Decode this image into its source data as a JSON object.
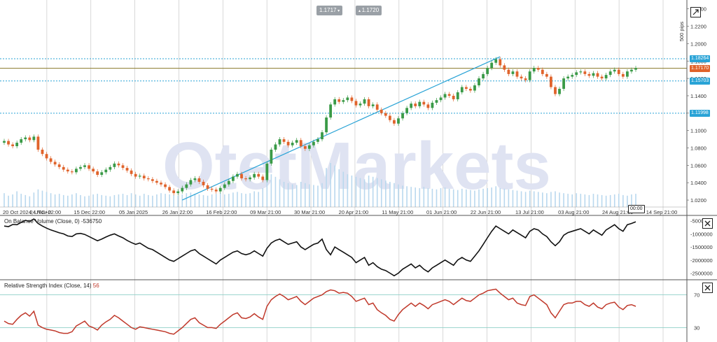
{
  "header": {
    "sell_price": "1.1717",
    "buy_price": "1.1720"
  },
  "main_chart": {
    "pips_label": "500 pips",
    "yticks": [
      "1.2400",
      "1.2200",
      "1.2000",
      "1.1800",
      "1.1600",
      "1.1400",
      "1.1200",
      "1.1000",
      "1.0800",
      "1.0600",
      "1.0400",
      "1.0200"
    ],
    "ytick_values": [
      1.24,
      1.22,
      1.2,
      1.18,
      1.16,
      1.14,
      1.12,
      1.1,
      1.08,
      1.06,
      1.04,
      1.02
    ],
    "xticks": [
      "20 Oct 2024, UTC+0",
      "24 Nov 22:00",
      "15 Dec 22:00",
      "05 Jan 2025",
      "26 Jan 22:00",
      "16 Feb 22:00",
      "09 Mar 21:00",
      "30 Mar 21:00",
      "20 Apr 21:00",
      "11 May 21:00",
      "01 Jun 21:00",
      "22 Jun 21:00",
      "13 Jul 21:00",
      "03 Aug 21:00",
      "24 Aug 21:00",
      "14 Sep 21:00"
    ],
    "time_badge": "00:00",
    "levels": [
      {
        "value": 1.18264,
        "label": "1.18264",
        "color": "#29a3d6",
        "style": "dotted"
      },
      {
        "value": 1.1717,
        "label": "1.17170",
        "color": "#e0632b",
        "style": "solid"
      },
      {
        "value": 1.15703,
        "label": "1.15703",
        "color": "#29a3d6",
        "style": "dotted"
      },
      {
        "value": 1.11998,
        "label": "1.11998",
        "color": "#29a3d6",
        "style": "dotted"
      }
    ],
    "watermark": "OtetMarkets"
  },
  "indicators": {
    "obv_label": "On Balance Volume (Close, 0)",
    "obv_value": "-536750",
    "obv_yticks": [
      "-500000",
      "-1000000",
      "-1500000",
      "-2000000",
      "-2500000"
    ],
    "rsi_label": "Relative Strength Index (Close, 14)",
    "rsi_value": "56",
    "rsi_yticks": [
      "70",
      "30"
    ]
  },
  "chart_data": {
    "type": "candlestick",
    "symbol_note": "",
    "y_range": [
      1.012,
      1.247
    ],
    "up_color": "#3a9a47",
    "down_color": "#e0632b",
    "close": [
      1.088,
      1.084,
      1.082,
      1.086,
      1.09,
      1.092,
      1.089,
      1.093,
      1.078,
      1.073,
      1.068,
      1.064,
      1.061,
      1.058,
      1.055,
      1.053,
      1.052,
      1.056,
      1.058,
      1.06,
      1.056,
      1.053,
      1.049,
      1.052,
      1.055,
      1.058,
      1.062,
      1.06,
      1.057,
      1.054,
      1.05,
      1.047,
      1.048,
      1.045,
      1.044,
      1.042,
      1.04,
      1.038,
      1.035,
      1.031,
      1.028,
      1.03,
      1.034,
      1.038,
      1.043,
      1.045,
      1.041,
      1.037,
      1.033,
      1.032,
      1.03,
      1.034,
      1.038,
      1.042,
      1.047,
      1.05,
      1.045,
      1.044,
      1.046,
      1.05,
      1.047,
      1.043,
      1.062,
      1.078,
      1.084,
      1.09,
      1.087,
      1.083,
      1.086,
      1.089,
      1.082,
      1.079,
      1.083,
      1.087,
      1.09,
      1.098,
      1.115,
      1.13,
      1.136,
      1.133,
      1.135,
      1.138,
      1.134,
      1.129,
      1.131,
      1.136,
      1.128,
      1.13,
      1.124,
      1.12,
      1.117,
      1.112,
      1.108,
      1.114,
      1.12,
      1.126,
      1.131,
      1.128,
      1.133,
      1.13,
      1.126,
      1.132,
      1.135,
      1.138,
      1.142,
      1.14,
      1.136,
      1.144,
      1.15,
      1.148,
      1.146,
      1.152,
      1.16,
      1.165,
      1.172,
      1.178,
      1.182,
      1.175,
      1.17,
      1.165,
      1.168,
      1.162,
      1.16,
      1.158,
      1.168,
      1.172,
      1.17,
      1.165,
      1.162,
      1.15,
      1.142,
      1.148,
      1.16,
      1.162,
      1.164,
      1.167,
      1.168,
      1.165,
      1.163,
      1.166,
      1.162,
      1.16,
      1.164,
      1.168,
      1.17,
      1.165,
      1.162,
      1.168,
      1.17,
      1.172
    ],
    "obv": [
      -700000,
      -720000,
      -640000,
      -650000,
      -560000,
      -480000,
      -520000,
      -430000,
      -600000,
      -700000,
      -780000,
      -850000,
      -900000,
      -960000,
      -1000000,
      -1080000,
      -1100000,
      -1000000,
      -980000,
      -1020000,
      -1100000,
      -1180000,
      -1260000,
      -1200000,
      -1120000,
      -1050000,
      -1000000,
      -1080000,
      -1150000,
      -1250000,
      -1330000,
      -1400000,
      -1350000,
      -1450000,
      -1550000,
      -1600000,
      -1700000,
      -1800000,
      -1900000,
      -2000000,
      -2050000,
      -1950000,
      -1850000,
      -1750000,
      -1650000,
      -1600000,
      -1750000,
      -1850000,
      -1950000,
      -2050000,
      -2150000,
      -2000000,
      -1900000,
      -1800000,
      -1700000,
      -1650000,
      -1750000,
      -1800000,
      -1750000,
      -1650000,
      -1750000,
      -1850000,
      -1550000,
      -1350000,
      -1250000,
      -1200000,
      -1300000,
      -1400000,
      -1350000,
      -1300000,
      -1500000,
      -1600000,
      -1500000,
      -1400000,
      -1350000,
      -1200000,
      -1600000,
      -1800000,
      -1500000,
      -1600000,
      -1700000,
      -1800000,
      -1900000,
      -2100000,
      -2000000,
      -1900000,
      -2200000,
      -2100000,
      -2250000,
      -2350000,
      -2400000,
      -2500000,
      -2600000,
      -2500000,
      -2350000,
      -2250000,
      -2150000,
      -2300000,
      -2200000,
      -2350000,
      -2450000,
      -2300000,
      -2200000,
      -2100000,
      -2000000,
      -2100000,
      -2200000,
      -2000000,
      -1900000,
      -2000000,
      -2050000,
      -1850000,
      -1650000,
      -1400000,
      -1150000,
      -900000,
      -700000,
      -800000,
      -900000,
      -1000000,
      -850000,
      -950000,
      -1050000,
      -1150000,
      -900000,
      -800000,
      -850000,
      -1000000,
      -1100000,
      -1300000,
      -1450000,
      -1300000,
      -1050000,
      -950000,
      -900000,
      -850000,
      -800000,
      -900000,
      -1000000,
      -850000,
      -950000,
      -1050000,
      -850000,
      -750000,
      -650000,
      -800000,
      -900000,
      -650000,
      -600000,
      -536750
    ],
    "rsi": [
      38,
      35,
      34,
      40,
      45,
      48,
      44,
      50,
      33,
      30,
      28,
      27,
      26,
      24,
      23,
      23,
      25,
      32,
      35,
      38,
      32,
      30,
      27,
      33,
      37,
      40,
      45,
      42,
      38,
      34,
      30,
      28,
      31,
      30,
      29,
      28,
      27,
      26,
      25,
      23,
      22,
      26,
      30,
      35,
      40,
      42,
      36,
      33,
      30,
      30,
      29,
      34,
      38,
      42,
      46,
      48,
      42,
      41,
      43,
      47,
      43,
      40,
      56,
      64,
      68,
      71,
      68,
      64,
      66,
      68,
      62,
      58,
      62,
      66,
      68,
      70,
      74,
      76,
      75,
      72,
      73,
      72,
      68,
      62,
      64,
      66,
      58,
      60,
      52,
      48,
      45,
      40,
      38,
      46,
      52,
      56,
      60,
      56,
      60,
      57,
      53,
      58,
      60,
      62,
      64,
      62,
      58,
      62,
      66,
      63,
      62,
      66,
      70,
      72,
      75,
      76,
      77,
      72,
      68,
      64,
      66,
      60,
      58,
      57,
      68,
      70,
      66,
      62,
      58,
      48,
      42,
      50,
      58,
      60,
      60,
      62,
      62,
      58,
      56,
      60,
      55,
      53,
      58,
      60,
      61,
      55,
      52,
      57,
      58,
      56
    ],
    "volume": [
      0.22,
      0.18,
      0.2,
      0.25,
      0.21,
      0.19,
      0.17,
      0.23,
      0.28,
      0.26,
      0.24,
      0.22,
      0.2,
      0.21,
      0.19,
      0.18,
      0.2,
      0.22,
      0.19,
      0.17,
      0.18,
      0.2,
      0.21,
      0.19,
      0.18,
      0.17,
      0.19,
      0.2,
      0.21,
      0.19,
      0.22,
      0.2,
      0.18,
      0.21,
      0.19,
      0.18,
      0.2,
      0.22,
      0.21,
      0.2,
      0.19,
      0.18,
      0.2,
      0.22,
      0.23,
      0.21,
      0.2,
      0.19,
      0.18,
      0.2,
      0.21,
      0.22,
      0.2,
      0.21,
      0.23,
      0.24,
      0.22,
      0.21,
      0.22,
      0.25,
      0.24,
      0.3,
      0.45,
      0.52,
      0.48,
      0.44,
      0.4,
      0.38,
      0.36,
      0.35,
      0.4,
      0.38,
      0.36,
      0.35,
      0.34,
      0.38,
      0.62,
      0.7,
      0.66,
      0.6,
      0.56,
      0.52,
      0.5,
      0.48,
      0.46,
      0.44,
      0.5,
      0.48,
      0.46,
      0.44,
      0.42,
      0.4,
      0.38,
      0.36,
      0.34,
      0.33,
      0.32,
      0.31,
      0.3,
      0.32,
      0.3,
      0.29,
      0.28,
      0.3,
      0.31,
      0.29,
      0.28,
      0.27,
      0.29,
      0.28,
      0.27,
      0.26,
      0.28,
      0.29,
      0.3,
      0.31,
      0.33,
      0.3,
      0.29,
      0.28,
      0.27,
      0.26,
      0.25,
      0.24,
      0.26,
      0.25,
      0.24,
      0.23,
      0.22,
      0.24,
      0.25,
      0.23,
      0.22,
      0.21,
      0.2,
      0.22,
      0.21,
      0.2,
      0.19,
      0.21,
      0.2,
      0.19,
      0.18,
      0.19,
      0.2,
      0.21,
      0.19,
      0.18,
      0.2,
      0.21
    ],
    "trendline": {
      "start_index": 42,
      "start_value": 1.02,
      "end_index": 117,
      "end_value": 1.185,
      "color": "#29a3d6"
    }
  }
}
